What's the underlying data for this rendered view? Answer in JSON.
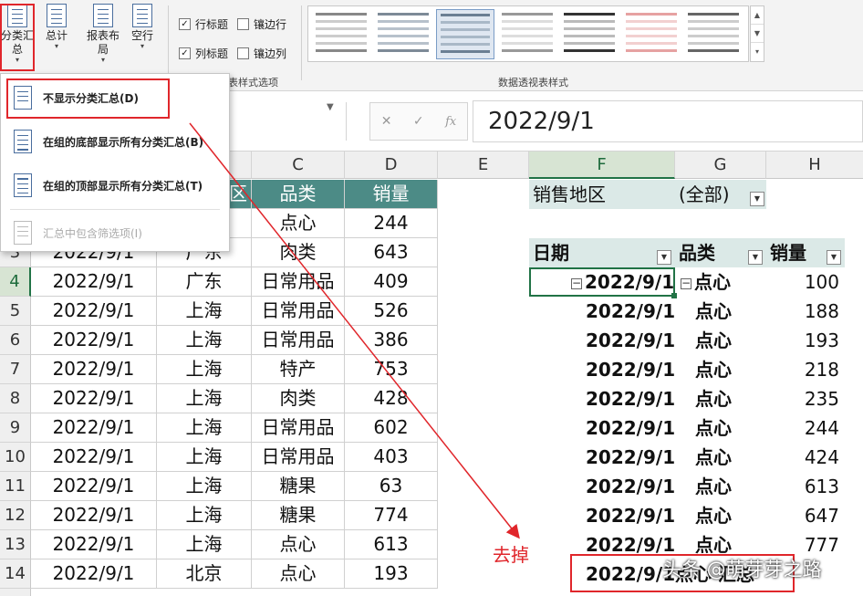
{
  "ribbon": {
    "subtotal_line1": "分类汇",
    "subtotal_line2": "总",
    "grandtotal_label": "总计",
    "report_layout_line1": "报表布",
    "report_layout_line2": "局",
    "blank_rows_label": "空行",
    "options": {
      "row_headers": "行标题",
      "banded_rows": "镶边行",
      "column_headers": "列标题",
      "banded_columns": "镶边列",
      "group_label_partial": "表样式选项"
    },
    "styles_group_label": "数据透视表样式"
  },
  "subtotal_menu": {
    "items": [
      {
        "label": "不显示分类汇总(D)",
        "enabled": true
      },
      {
        "label": "在组的底部显示所有分类汇总(B)",
        "enabled": true
      },
      {
        "label": "在组的顶部显示所有分类汇总(T)",
        "enabled": true
      },
      {
        "label": "汇总中包含筛选项(I)",
        "enabled": false
      }
    ]
  },
  "formula_bar": {
    "cancel_glyph": "✕",
    "enter_glyph": "✓",
    "fx_glyph": "fx",
    "value": "2022/9/1"
  },
  "columns": [
    "C",
    "D",
    "E",
    "F",
    "G",
    "H"
  ],
  "rows": [
    "3",
    "4",
    "5",
    "6",
    "7",
    "8",
    "9",
    "10",
    "11",
    "12",
    "13",
    "14"
  ],
  "source_table": {
    "headers": {
      "region_partial": "区",
      "category": "品类",
      "quantity": "销量"
    },
    "first_row": {
      "category": "点心",
      "quantity": "244"
    },
    "rows": [
      {
        "date": "2022/9/1",
        "region": "广东",
        "category": "肉类",
        "quantity": "643"
      },
      {
        "date": "2022/9/1",
        "region": "广东",
        "category": "日常用品",
        "quantity": "409"
      },
      {
        "date": "2022/9/1",
        "region": "上海",
        "category": "日常用品",
        "quantity": "526"
      },
      {
        "date": "2022/9/1",
        "region": "上海",
        "category": "日常用品",
        "quantity": "386"
      },
      {
        "date": "2022/9/1",
        "region": "上海",
        "category": "特产",
        "quantity": "753"
      },
      {
        "date": "2022/9/1",
        "region": "上海",
        "category": "肉类",
        "quantity": "428"
      },
      {
        "date": "2022/9/1",
        "region": "上海",
        "category": "日常用品",
        "quantity": "602"
      },
      {
        "date": "2022/9/1",
        "region": "上海",
        "category": "日常用品",
        "quantity": "403"
      },
      {
        "date": "2022/9/1",
        "region": "上海",
        "category": "糖果",
        "quantity": "63"
      },
      {
        "date": "2022/9/1",
        "region": "上海",
        "category": "糖果",
        "quantity": "774"
      },
      {
        "date": "2022/9/1",
        "region": "上海",
        "category": "点心",
        "quantity": "613"
      },
      {
        "date": "2022/9/1",
        "region": "北京",
        "category": "点心",
        "quantity": "193"
      }
    ]
  },
  "pivot": {
    "filter_label": "销售地区",
    "filter_value": "(全部)",
    "headers": {
      "date": "日期",
      "category": "品类",
      "quantity": "销量"
    },
    "rows": [
      {
        "date": "2022/9/1",
        "category": "点心",
        "quantity": "100"
      },
      {
        "date": "2022/9/1",
        "category": "点心",
        "quantity": "188"
      },
      {
        "date": "2022/9/1",
        "category": "点心",
        "quantity": "193"
      },
      {
        "date": "2022/9/1",
        "category": "点心",
        "quantity": "218"
      },
      {
        "date": "2022/9/1",
        "category": "点心",
        "quantity": "235"
      },
      {
        "date": "2022/9/1",
        "category": "点心",
        "quantity": "244"
      },
      {
        "date": "2022/9/1",
        "category": "点心",
        "quantity": "424"
      },
      {
        "date": "2022/9/1",
        "category": "点心",
        "quantity": "613"
      },
      {
        "date": "2022/9/1",
        "category": "点心",
        "quantity": "647"
      },
      {
        "date": "2022/9/1",
        "category": "点心",
        "quantity": "777"
      }
    ],
    "total_row": {
      "date": "2022/9/1",
      "category": "点心 汇总"
    }
  },
  "annotation": {
    "text": "去掉",
    "color": "#e0262b"
  },
  "watermark": "头条 @萌芽芽之路",
  "colors": {
    "header_teal": "#4c8b86",
    "pivot_header_bg": "#dbe9e7",
    "excel_green": "#217346"
  }
}
